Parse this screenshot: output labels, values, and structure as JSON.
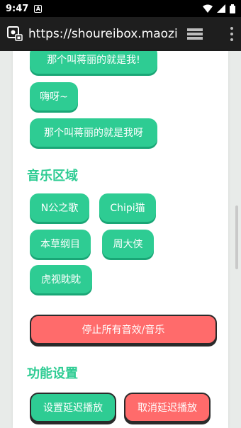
{
  "status": {
    "time": "9:47",
    "notification": "A"
  },
  "browser": {
    "url": "https://shoureibox.maozi"
  },
  "voice_buttons": [
    "那个叫蒋丽的就是我!",
    "嗨呀~",
    "那个叫蒋丽的就是我呀"
  ],
  "music_section": {
    "title": "音乐区域",
    "buttons": [
      "N公之歌",
      "Chipi猫",
      "本草纲目",
      "周大侠",
      "虎视眈眈"
    ]
  },
  "stop_all_label": "停止所有音效/音乐",
  "settings_section": {
    "title": "功能设置",
    "set_delay_label": "设置延迟播放",
    "cancel_delay_label": "取消延迟播放"
  },
  "colors": {
    "accent": "#2ecc93",
    "danger": "#ff6b6b"
  }
}
